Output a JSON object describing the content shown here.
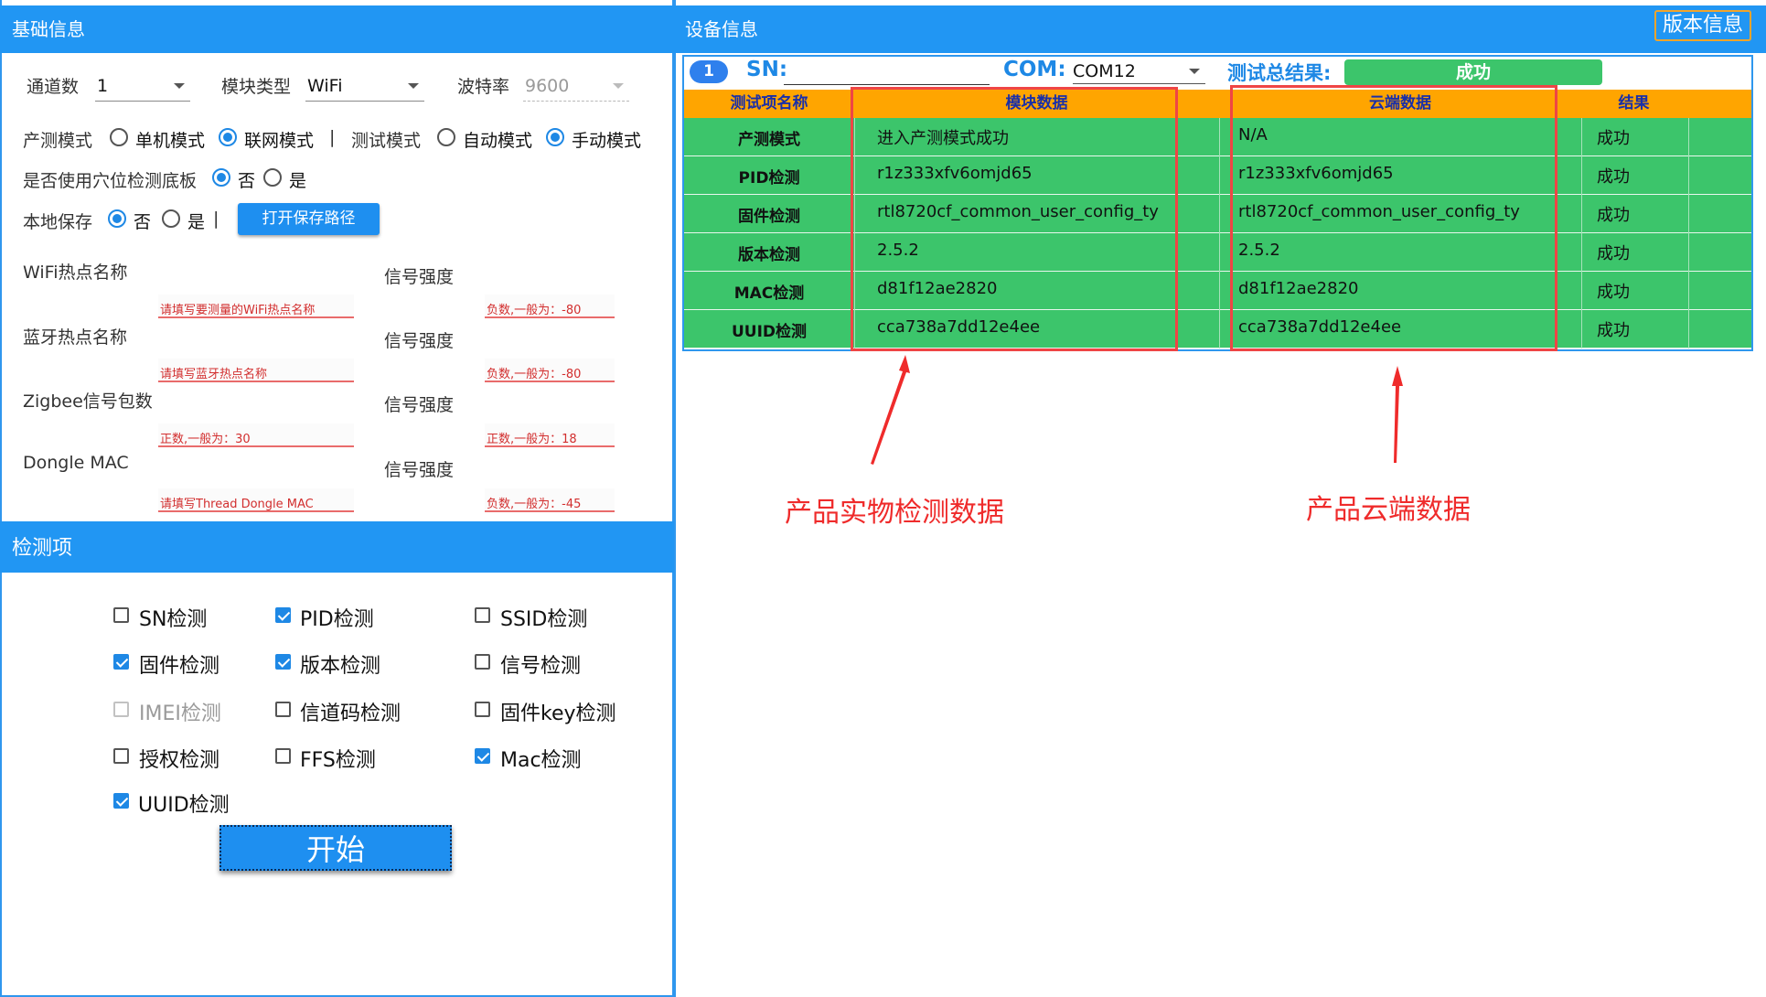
{
  "left": {
    "basic_title": "基础信息",
    "channel_label": "通道数",
    "channel_value": "1",
    "module_type_label": "模块类型",
    "module_type_value": "WiFi",
    "baud_label": "波特率",
    "baud_value": "9600",
    "prod_mode_label": "产测模式",
    "prod_mode_single": "单机模式",
    "prod_mode_network": "联网模式",
    "sep": "|",
    "test_mode_label": "测试模式",
    "test_mode_auto": "自动模式",
    "test_mode_manual": "手动模式",
    "fixture_label": "是否使用穴位检测底板",
    "no_label": "否",
    "yes_label": "是",
    "local_save_label": "本地保存",
    "open_path_button": "打开保存路径",
    "wifi_hotspot_label": "WiFi热点名称",
    "wifi_hotspot_placeholder": "请填写要测量的WiFi热点名称",
    "signal_label": "信号强度",
    "wifi_signal_placeholder": "负数,一般为：-80",
    "bt_hotspot_label": "蓝牙热点名称",
    "bt_hotspot_placeholder": "请填写蓝牙热点名称",
    "bt_signal_placeholder": "负数,一般为：-80",
    "zigbee_label": "Zigbee信号包数",
    "zigbee_placeholder": "正数,一般为：30",
    "zigbee_signal_placeholder": "正数,一般为：18",
    "dongle_label": "Dongle MAC",
    "dongle_placeholder": "请填写Thread Dongle MAC",
    "dongle_signal_placeholder": "负数,一般为：-45",
    "check_title": "检测项",
    "checks": [
      {
        "label": "SN检测"
      },
      {
        "label": "PID检测"
      },
      {
        "label": "SSID检测"
      },
      {
        "label": "固件检测"
      },
      {
        "label": "版本检测"
      },
      {
        "label": "信号检测"
      },
      {
        "label": "IMEI检测"
      },
      {
        "label": "信道码检测"
      },
      {
        "label": "固件key检测"
      },
      {
        "label": "授权检测"
      },
      {
        "label": "FFS检测"
      },
      {
        "label": "Mac检测"
      },
      {
        "label": "UUID检测"
      }
    ],
    "start_button": "开始"
  },
  "right": {
    "device_title": "设备信息",
    "version_button": "版本信息",
    "channel_badge": "1",
    "sn_label": "SN:",
    "com_label": "COM:",
    "com_value": "COM12",
    "total_result_label": "测试总结果:",
    "total_result_value": "成功",
    "columns": [
      "测试项名称",
      "模块数据",
      "云端数据",
      "结果"
    ],
    "rows": [
      {
        "name": "产测模式",
        "module": "进入产测模式成功",
        "cloud": "N/A",
        "result": "成功"
      },
      {
        "name": "PID检测",
        "module": "r1z333xfv6omjd65",
        "cloud": "r1z333xfv6omjd65",
        "result": "成功"
      },
      {
        "name": "固件检测",
        "module": "rtl8720cf_common_user_config_ty",
        "cloud": "rtl8720cf_common_user_config_ty",
        "result": "成功"
      },
      {
        "name": "版本检测",
        "module": "2.5.2",
        "cloud": "2.5.2",
        "result": "成功"
      },
      {
        "name": "MAC检测",
        "module": "d81f12ae2820",
        "cloud": "d81f12ae2820",
        "result": "成功"
      },
      {
        "name": "UUID检测",
        "module": "cca738a7dd12e4ee",
        "cloud": "cca738a7dd12e4ee",
        "result": "成功"
      }
    ],
    "annotation_module": "产品实物检测数据",
    "annotation_cloud": "产品云端数据"
  },
  "colors": {
    "header_blue": "#2196f3",
    "table_green": "#3cc56b",
    "header_orange": "#ffa500",
    "annotation_red": "#ef2b2b"
  }
}
